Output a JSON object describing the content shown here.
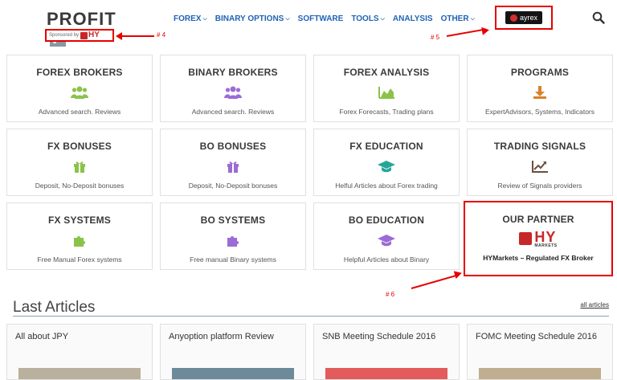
{
  "brand": {
    "logo_text": "PROFIT",
    "logo_letter": "F",
    "sponsor_label": "Sponsored by",
    "sponsor_hy": "HY"
  },
  "annotations": {
    "a4": "# 4",
    "a5": "# 5",
    "a6": "# 6"
  },
  "nav": {
    "items": [
      {
        "label": "FOREX",
        "dropdown": true
      },
      {
        "label": "BINARY OPTIONS",
        "dropdown": true
      },
      {
        "label": "SOFTWARE",
        "dropdown": false
      },
      {
        "label": "TOOLS",
        "dropdown": true
      },
      {
        "label": "ANALYSIS",
        "dropdown": false
      },
      {
        "label": "OTHER",
        "dropdown": true
      }
    ],
    "ayrex_label": "ayrex",
    "search_icon": "search-icon"
  },
  "tiles": [
    {
      "title": "FOREX BROKERS",
      "desc": "Advanced search. Reviews",
      "icon": "users-icon"
    },
    {
      "title": "BINARY BROKERS",
      "desc": "Advanced search. Reviews",
      "icon": "users-icon"
    },
    {
      "title": "FOREX ANALYSIS",
      "desc": "Forex Forecasts, Trading plans",
      "icon": "area-chart-icon"
    },
    {
      "title": "PROGRAMS",
      "desc": "ExpertAdvisors, Systems, Indicators",
      "icon": "download-icon"
    },
    {
      "title": "FX BONUSES",
      "desc": "Deposit, No-Deposit bonuses",
      "icon": "gift-icon"
    },
    {
      "title": "BO BONUSES",
      "desc": "Deposit, No-Deposit bonuses",
      "icon": "gift-icon"
    },
    {
      "title": "FX EDUCATION",
      "desc": "Helful Articles about Forex trading",
      "icon": "graduation-cap-icon"
    },
    {
      "title": "TRADING SIGNALS",
      "desc": "Review of Signals providers",
      "icon": "line-chart-icon"
    },
    {
      "title": "FX SYSTEMS",
      "desc": "Free Manual Forex systems",
      "icon": "puzzle-icon"
    },
    {
      "title": "BO SYSTEMS",
      "desc": "Free manual Binary systems",
      "icon": "puzzle-icon"
    },
    {
      "title": "BO EDUCATION",
      "desc": "Helpful Articles about Binary",
      "icon": "graduation-cap-icon"
    }
  ],
  "partner": {
    "title": "OUR PARTNER",
    "logo_big": "HY",
    "logo_small": "MARKETS",
    "desc": "HYMarkets – Regulated FX Broker"
  },
  "articles_section": {
    "title": "Last Articles",
    "all_link": "all articles",
    "items": [
      {
        "title": "All about JPY"
      },
      {
        "title": "Anyoption platform Review"
      },
      {
        "title": "SNB Meeting Schedule 2016"
      },
      {
        "title": "FOMC Meeting Schedule 2016"
      }
    ]
  },
  "colors": {
    "nav_blue": "#1f63b3",
    "icon_green": "#8bc34a",
    "icon_purple": "#9c6bd6",
    "icon_teal": "#26a69a",
    "icon_orange": "#d9822b",
    "annotation_red": "#e60000"
  }
}
